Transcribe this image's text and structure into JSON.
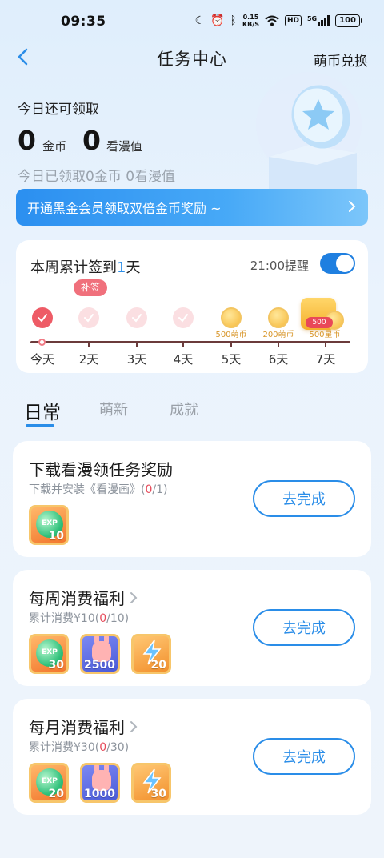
{
  "status_bar": {
    "time": "09:35",
    "net_speed_value": "0.15",
    "net_speed_unit": "KB/S",
    "hd_badge": "HD",
    "signal_label": "5G",
    "battery": "100"
  },
  "header": {
    "title": "任务中心",
    "right_link": "萌币兑换"
  },
  "hero": {
    "label": "今日还可领取",
    "coins_value": "0",
    "coins_unit": "金币",
    "views_value": "0",
    "views_unit": "看漫值",
    "received_text": "今日已领取0金币 0看漫值",
    "vip_banner_text": "开通黑金会员领取双倍金币奖励 ~"
  },
  "sign_in": {
    "title_prefix": "本周累计签到",
    "days_count": "1",
    "title_suffix": "天",
    "remind_text": "21:00提醒",
    "remind_enabled": true,
    "makeup_tag": "补签",
    "big_reward_pill": "500",
    "days": [
      {
        "label": "今天",
        "state": "done",
        "reward": ""
      },
      {
        "label": "2天",
        "state": "pending",
        "reward": ""
      },
      {
        "label": "3天",
        "state": "pending",
        "reward": ""
      },
      {
        "label": "4天",
        "state": "pending",
        "reward": ""
      },
      {
        "label": "5天",
        "state": "coin",
        "reward": "500萌币"
      },
      {
        "label": "6天",
        "state": "coin",
        "reward": "200萌币"
      },
      {
        "label": "7天",
        "state": "big",
        "reward": "500星币"
      }
    ]
  },
  "tabs": [
    {
      "label": "日常",
      "active": true
    },
    {
      "label": "萌新",
      "active": false
    },
    {
      "label": "成就",
      "active": false
    }
  ],
  "tasks": [
    {
      "title": "下载看漫领任务奖励",
      "desc_prefix": "下载并安装《看漫画》(",
      "progress_current": "0",
      "progress_suffix": "/1)",
      "button": "去完成",
      "rewards": [
        {
          "type": "exp",
          "label": "EXP",
          "qty": "10"
        }
      ]
    },
    {
      "title": "每周消费福利",
      "desc_prefix": "累计消费¥10(",
      "progress_current": "0",
      "progress_suffix": "/10)",
      "button": "去完成",
      "rewards": [
        {
          "type": "exp",
          "label": "EXP",
          "qty": "30"
        },
        {
          "type": "coin",
          "label": "",
          "qty": "2500"
        },
        {
          "type": "bolt",
          "label": "",
          "qty": "20"
        }
      ]
    },
    {
      "title": "每月消费福利",
      "desc_prefix": "累计消费¥30(",
      "progress_current": "0",
      "progress_suffix": "/30)",
      "button": "去完成",
      "rewards": [
        {
          "type": "exp",
          "label": "EXP",
          "qty": "20"
        },
        {
          "type": "coin",
          "label": "",
          "qty": "1000"
        },
        {
          "type": "bolt",
          "label": "",
          "qty": "30"
        }
      ]
    }
  ],
  "colors": {
    "accent_blue": "#2a8de8",
    "signin_red": "#ee5b66",
    "progress_red": "#e64a5a"
  }
}
